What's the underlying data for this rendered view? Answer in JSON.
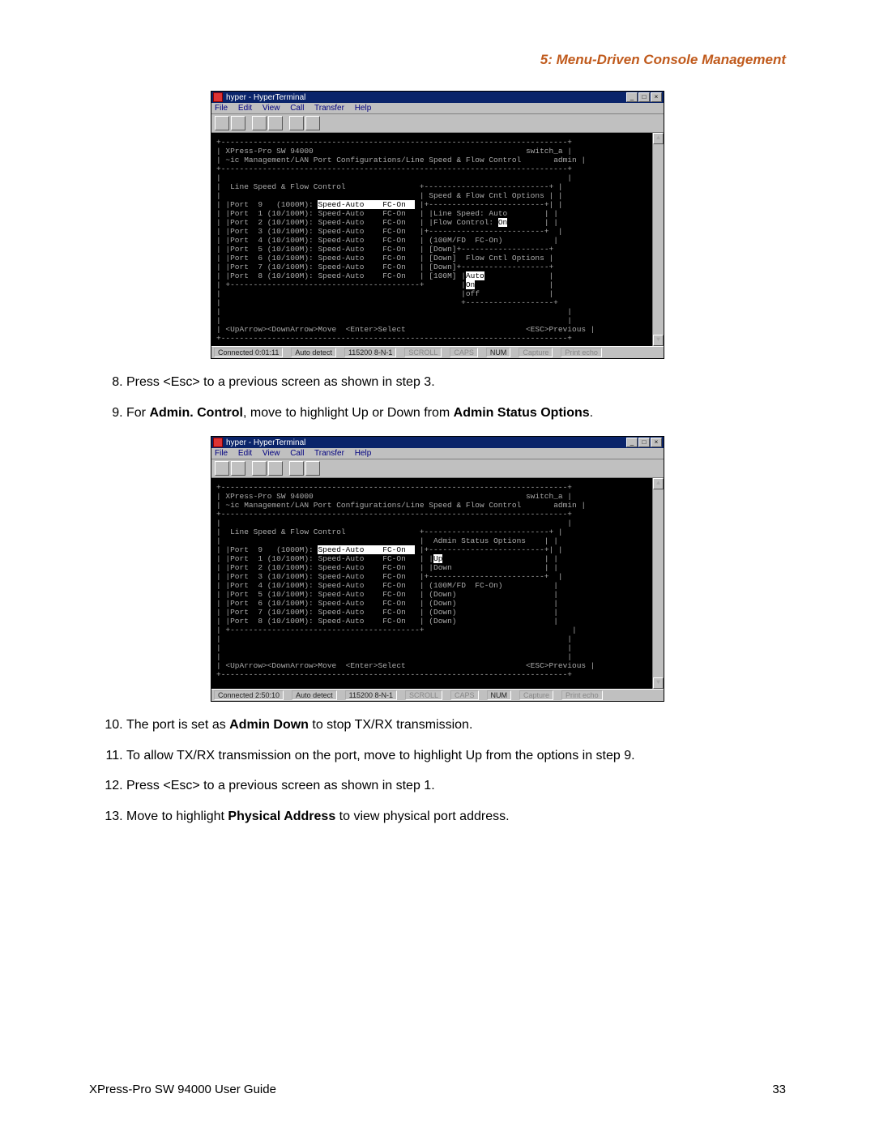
{
  "header": {
    "chapter_title": "5: Menu-Driven Console Management"
  },
  "hyperterminal_common": {
    "title": "hyper - HyperTerminal",
    "menubar": [
      "File",
      "Edit",
      "View",
      "Call",
      "Transfer",
      "Help"
    ],
    "sys_buttons": {
      "min": "_",
      "max": "□",
      "close": "×"
    }
  },
  "terminal1": {
    "header_left": "XPress-Pro SW 94000",
    "header_right_top": "switch_a",
    "header_right_bot": "admin",
    "breadcrumb": "~ic Management/LAN Port Configurations/Line Speed & Flow Control",
    "section_title": "Line Speed & Flow Control",
    "right_panel_title": "Speed & Flow Cntl Options",
    "ports": [
      {
        "n": "9",
        "cap": "(1000M)",
        "speed": "Speed-Auto",
        "fc": "FC-On",
        "hl": true
      },
      {
        "n": "1",
        "cap": "(10/100M)",
        "speed": "Speed-Auto",
        "fc": "FC-On"
      },
      {
        "n": "2",
        "cap": "(10/100M)",
        "speed": "Speed-Auto",
        "fc": "FC-On"
      },
      {
        "n": "3",
        "cap": "(10/100M)",
        "speed": "Speed-Auto",
        "fc": "FC-On"
      },
      {
        "n": "4",
        "cap": "(10/100M)",
        "speed": "Speed-Auto",
        "fc": "FC-On"
      },
      {
        "n": "5",
        "cap": "(10/100M)",
        "speed": "Speed-Auto",
        "fc": "FC-On"
      },
      {
        "n": "6",
        "cap": "(10/100M)",
        "speed": "Speed-Auto",
        "fc": "FC-On"
      },
      {
        "n": "7",
        "cap": "(10/100M)",
        "speed": "Speed-Auto",
        "fc": "FC-On"
      },
      {
        "n": "8",
        "cap": "(10/100M)",
        "speed": "Speed-Auto",
        "fc": "FC-On"
      }
    ],
    "right_panel": {
      "line_speed_label": "Line Speed:",
      "line_speed_value": "Auto",
      "flow_control_label": "Flow Control:",
      "flow_control_value": "On",
      "status_summary": "(100M/FD  FC-On)",
      "down_rows": [
        "[Down]",
        "[Down]  Flow Cntl Options",
        "[Down]",
        "[100M]"
      ],
      "fc_options": [
        "Auto",
        "On",
        "off"
      ]
    },
    "footer_nav": "<UpArrow><DownArrow>Move  <Enter>Select",
    "footer_esc": "<ESC>Previous",
    "statusbar": {
      "connected": "Connected 0:01:11",
      "autodetect": "Auto detect",
      "baud": "115200 8-N-1",
      "scroll": "SCROLL",
      "caps": "CAPS",
      "num": "NUM",
      "capture": "Capture",
      "printecho": "Print echo"
    }
  },
  "steps_block1": {
    "s8": {
      "pre": "Press <Esc> to a previous screen as shown in step 3."
    },
    "s9": {
      "pre": "For ",
      "b1": "Admin. Control",
      "mid": ", move to highlight Up or Down from ",
      "b2": "Admin Status Options",
      "post": "."
    }
  },
  "terminal2": {
    "header_left": "XPress-Pro SW 94000",
    "header_right_top": "switch_a",
    "header_right_bot": "admin",
    "breadcrumb": "~ic Management/LAN Port Configurations/Line Speed & Flow Control",
    "section_title": "Line Speed & Flow Control",
    "right_panel_title": "Admin Status Options",
    "ports": [
      {
        "n": "9",
        "cap": "(1000M)",
        "speed": "Speed-Auto",
        "fc": "FC-On",
        "hl": true
      },
      {
        "n": "1",
        "cap": "(10/100M)",
        "speed": "Speed-Auto",
        "fc": "FC-On"
      },
      {
        "n": "2",
        "cap": "(10/100M)",
        "speed": "Speed-Auto",
        "fc": "FC-On"
      },
      {
        "n": "3",
        "cap": "(10/100M)",
        "speed": "Speed-Auto",
        "fc": "FC-On"
      },
      {
        "n": "4",
        "cap": "(10/100M)",
        "speed": "Speed-Auto",
        "fc": "FC-On"
      },
      {
        "n": "5",
        "cap": "(10/100M)",
        "speed": "Speed-Auto",
        "fc": "FC-On"
      },
      {
        "n": "6",
        "cap": "(10/100M)",
        "speed": "Speed-Auto",
        "fc": "FC-On"
      },
      {
        "n": "7",
        "cap": "(10/100M)",
        "speed": "Speed-Auto",
        "fc": "FC-On"
      },
      {
        "n": "8",
        "cap": "(10/100M)",
        "speed": "Speed-Auto",
        "fc": "FC-On"
      }
    ],
    "right_panel": {
      "options": [
        "Up",
        "Down"
      ],
      "status_summary": "(100M/FD  FC-On)",
      "down_rows": [
        "(Down)",
        "(Down)",
        "(Down)",
        "(Down)"
      ]
    },
    "footer_nav": "<UpArrow><DownArrow>Move  <Enter>Select",
    "footer_esc": "<ESC>Previous",
    "statusbar": {
      "connected": "Connected 2:50:10",
      "autodetect": "Auto detect",
      "baud": "115200 8-N-1",
      "scroll": "SCROLL",
      "caps": "CAPS",
      "num": "NUM",
      "capture": "Capture",
      "printecho": "Print echo"
    }
  },
  "steps_block2": {
    "s10": {
      "pre": "The port is set as ",
      "b1": "Admin Down",
      "post": " to stop TX/RX transmission."
    },
    "s11": {
      "text": "To allow TX/RX transmission on the port, move to highlight Up from the options in step 9."
    },
    "s12": {
      "text": "Press <Esc> to a previous screen as shown in step 1."
    },
    "s13": {
      "pre": "Move to highlight ",
      "b1": "Physical Address",
      "post": " to view physical port address."
    }
  },
  "footer": {
    "left": "XPress-Pro SW 94000 User Guide",
    "right": "33"
  }
}
